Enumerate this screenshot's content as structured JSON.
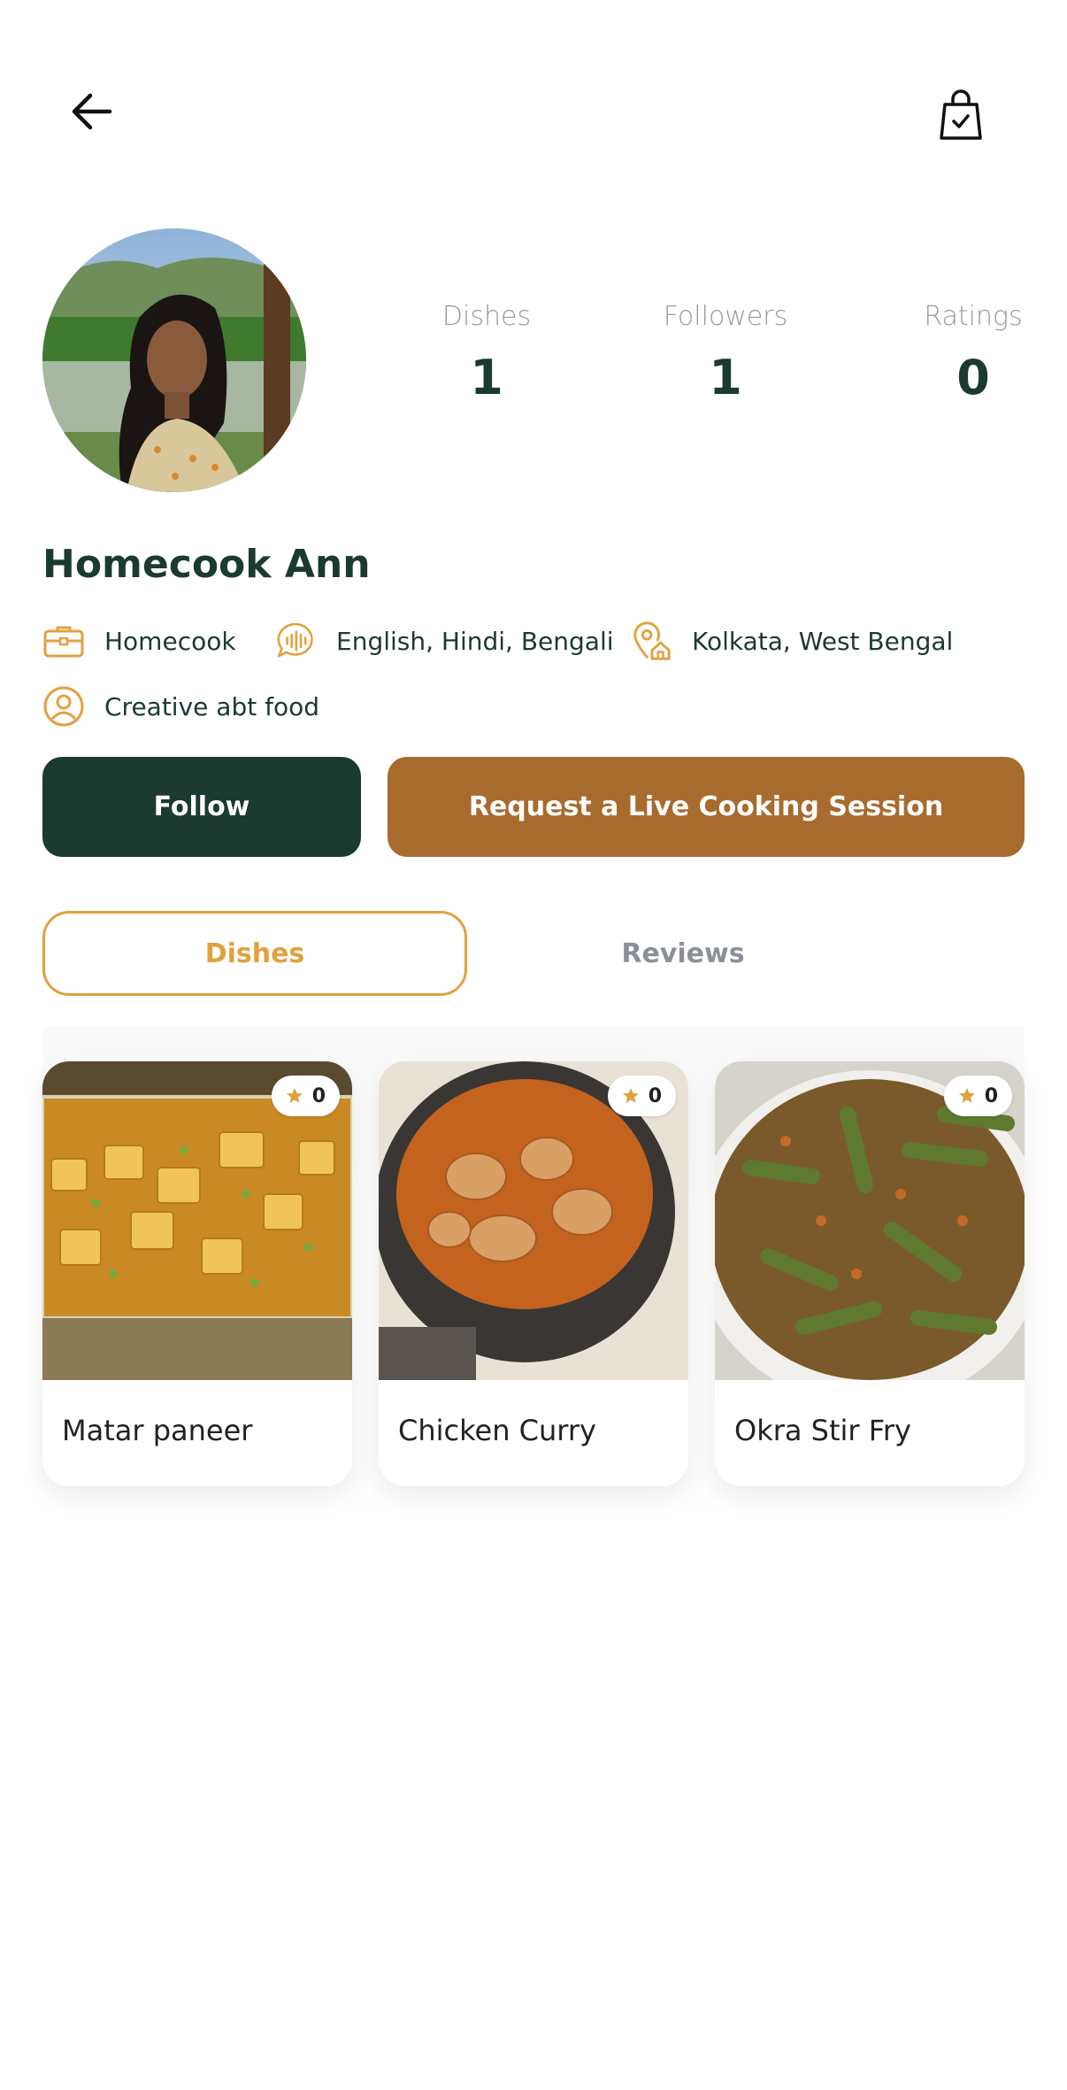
{
  "header": {
    "back_icon": "arrow-left-icon",
    "bag_icon": "shopping-bag-check-icon"
  },
  "profile": {
    "name": "Homecook Ann",
    "stats": [
      {
        "label": "Dishes",
        "value": "1"
      },
      {
        "label": "Followers",
        "value": "1"
      },
      {
        "label": "Ratings",
        "value": "0"
      }
    ],
    "info": {
      "role": "Homecook",
      "languages": "English, Hindi, Bengali",
      "location": "Kolkata, West Bengal",
      "bio": "Creative abt food"
    }
  },
  "actions": {
    "follow_label": "Follow",
    "request_label": "Request a Live Cooking Session"
  },
  "tabs": [
    {
      "label": "Dishes",
      "active": true
    },
    {
      "label": "Reviews",
      "active": false
    }
  ],
  "dishes": [
    {
      "title": "Matar paneer",
      "rating": "0"
    },
    {
      "title": "Chicken Curry",
      "rating": "0"
    },
    {
      "title": "Okra Stir Fry",
      "rating": "0"
    }
  ],
  "colors": {
    "primary_dark": "#1b3a30",
    "accent_brown": "#a86b2e",
    "accent_orange": "#e2a13e"
  }
}
